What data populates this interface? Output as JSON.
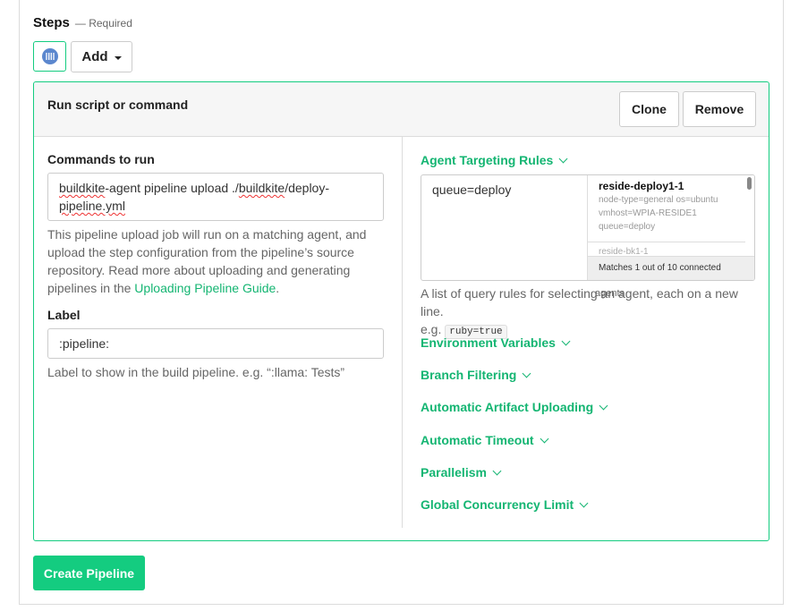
{
  "steps": {
    "title": "Steps",
    "required": "— Required",
    "add_label": "Add"
  },
  "step_panel": {
    "title": "Run script or command",
    "clone_label": "Clone",
    "remove_label": "Remove",
    "commands": {
      "label": "Commands to run",
      "value_part1": "buildkite",
      "value_part2": "-agent pipeline upload ./",
      "value_part3": "buildkite",
      "value_part4": "/deploy-",
      "value_part5": "pipeline.yml",
      "help_text": "This pipeline upload job will run on a matching agent, and upload the step configuration from the pipeline’s source repository. Read more about uploading and generating pipelines in the ",
      "help_link": "Uploading Pipeline Guide",
      "help_end": "."
    },
    "label_field": {
      "label": "Label",
      "value": ":pipeline:",
      "help": "Label to show in the build pipeline. e.g. “:llama: Tests”"
    },
    "agent_targeting": {
      "title": "Agent Targeting Rules",
      "value": "queue=deploy",
      "agents": [
        {
          "name": "reside-deploy1-1",
          "meta": [
            "node-type=general os=ubuntu",
            "vmhost=WPIA-RESIDE1",
            "queue=deploy"
          ]
        },
        {
          "name": "reside-bk1-1"
        }
      ],
      "match_text": "Matches 1 out of 10 connected",
      "help_text_a": "A list of query rules for selecting an agent, each on a new line.",
      "overlay_text": "agents",
      "help_eg": "e.g.",
      "help_code": "ruby=true"
    },
    "sections": [
      "Environment Variables",
      "Branch Filtering",
      "Automatic Artifact Uploading",
      "Automatic Timeout",
      "Parallelism",
      "Global Concurrency Limit"
    ]
  },
  "create_label": "Create Pipeline"
}
